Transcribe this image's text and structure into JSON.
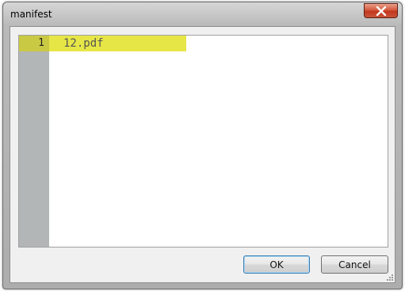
{
  "window": {
    "title": "manifest",
    "close_icon": "close-icon"
  },
  "editor": {
    "lines": [
      {
        "number": "1",
        "text": "12.pdf"
      }
    ]
  },
  "buttons": {
    "ok_label": "OK",
    "cancel_label": "Cancel"
  },
  "colors": {
    "current_line": "#e6e647",
    "gutter": "#b3b6b7",
    "close_button": "#c1381f"
  }
}
